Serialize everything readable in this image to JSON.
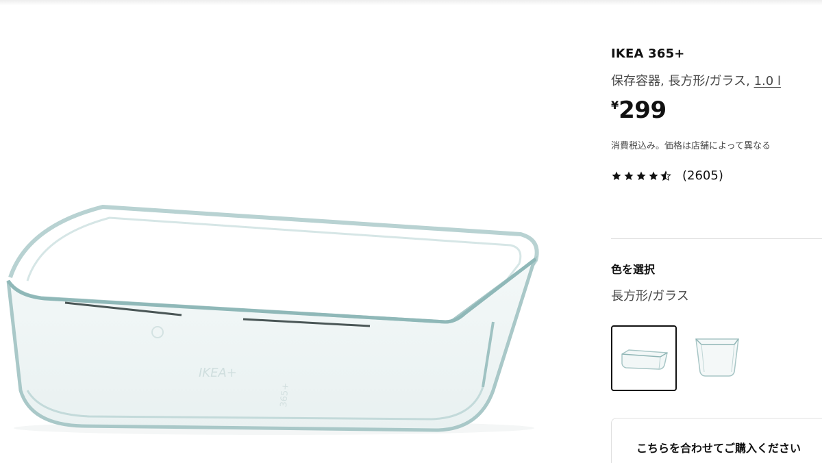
{
  "product": {
    "brand": "IKEA 365+",
    "description_main": "保存容器, 長方形/ガラス, ",
    "description_size": "1.0 l",
    "currency": "¥",
    "price": "299",
    "tax_note": "消費税込み。価格は店舗によって異なる",
    "rating_value": 4.5,
    "review_count": "(2605)",
    "image_icon": "glass-container-image"
  },
  "variants": {
    "heading": "色を選択",
    "selected_label": "長方形/ガラス",
    "options": [
      {
        "icon": "rectangular-container-thumbnail",
        "selected": true
      },
      {
        "icon": "square-container-thumbnail",
        "selected": false
      }
    ]
  },
  "bundle": {
    "label": "こちらを合わせてご購入ください"
  },
  "colors": {
    "text_primary": "#111111",
    "text_secondary": "#484848",
    "divider": "#dfdfdf"
  }
}
